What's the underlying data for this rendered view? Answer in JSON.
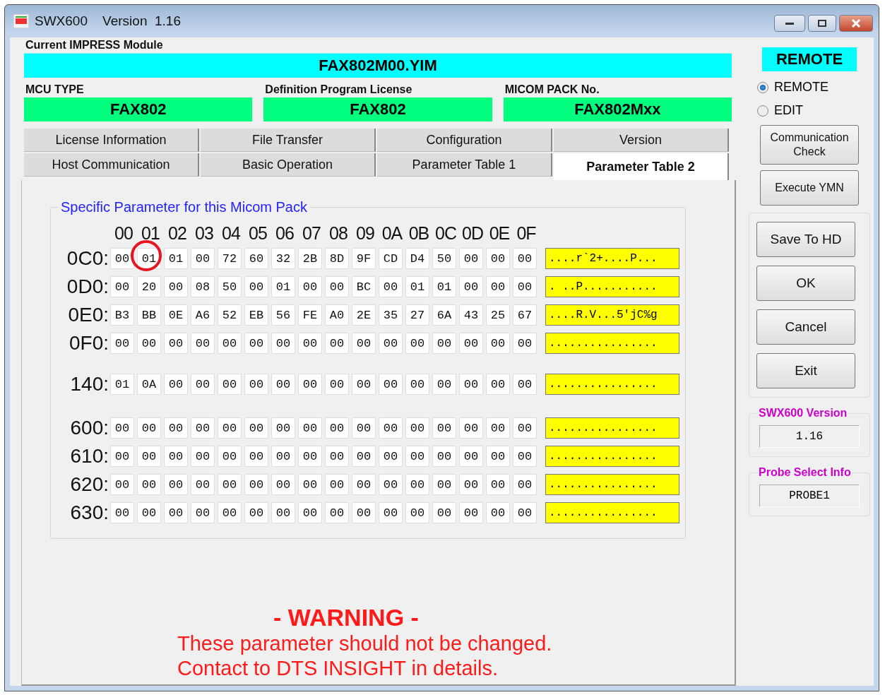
{
  "window": {
    "title": "SWX600    Version  1.16"
  },
  "module": {
    "label": "Current IMPRESS Module",
    "value": "FAX802M00.YIM"
  },
  "info_fields": [
    {
      "label": "MCU TYPE",
      "value": "FAX802"
    },
    {
      "label": "Definition Program License",
      "value": "FAX802"
    },
    {
      "label": "MICOM PACK No.",
      "value": "FAX802Mxx"
    }
  ],
  "tab_rows": [
    [
      {
        "label": "License Information",
        "selected": false
      },
      {
        "label": "File Transfer",
        "selected": false
      },
      {
        "label": "Configuration",
        "selected": false
      },
      {
        "label": "Version",
        "selected": false
      }
    ],
    [
      {
        "label": "Host Communication",
        "selected": false
      },
      {
        "label": "Basic Operation",
        "selected": false
      },
      {
        "label": "Parameter Table 1",
        "selected": false
      },
      {
        "label": "Parameter Table 2",
        "selected": true
      }
    ]
  ],
  "parameter_group": {
    "title": "Specific Parameter for this Micom Pack",
    "columns": [
      "00",
      "01",
      "02",
      "03",
      "04",
      "05",
      "06",
      "07",
      "08",
      "09",
      "0A",
      "0B",
      "0C",
      "0D",
      "0E",
      "0F"
    ],
    "blocks": [
      [
        {
          "address": "0C0:",
          "bytes": [
            "00",
            "01",
            "01",
            "00",
            "72",
            "60",
            "32",
            "2B",
            "8D",
            "9F",
            "CD",
            "D4",
            "50",
            "00",
            "00",
            "00"
          ],
          "circled": [
            false,
            true,
            false,
            false,
            false,
            false,
            false,
            false,
            false,
            false,
            false,
            false,
            false,
            false,
            false,
            false
          ],
          "ascii": "....r`2+....P..."
        },
        {
          "address": "0D0:",
          "bytes": [
            "00",
            "20",
            "00",
            "08",
            "50",
            "00",
            "01",
            "00",
            "00",
            "BC",
            "00",
            "01",
            "01",
            "00",
            "00",
            "00"
          ],
          "ascii": ". ..P..........."
        },
        {
          "address": "0E0:",
          "bytes": [
            "B3",
            "BB",
            "0E",
            "A6",
            "52",
            "EB",
            "56",
            "FE",
            "A0",
            "2E",
            "35",
            "27",
            "6A",
            "43",
            "25",
            "67"
          ],
          "ascii": "....R.V...5'jC%g"
        },
        {
          "address": "0F0:",
          "bytes": [
            "00",
            "00",
            "00",
            "00",
            "00",
            "00",
            "00",
            "00",
            "00",
            "00",
            "00",
            "00",
            "00",
            "00",
            "00",
            "00"
          ],
          "ascii": "................"
        }
      ],
      [
        {
          "address": "140:",
          "bytes": [
            "01",
            "0A",
            "00",
            "00",
            "00",
            "00",
            "00",
            "00",
            "00",
            "00",
            "00",
            "00",
            "00",
            "00",
            "00",
            "00"
          ],
          "ascii": "................"
        }
      ],
      [
        {
          "address": "600:",
          "bytes": [
            "00",
            "00",
            "00",
            "00",
            "00",
            "00",
            "00",
            "00",
            "00",
            "00",
            "00",
            "00",
            "00",
            "00",
            "00",
            "00"
          ],
          "ascii": "................"
        },
        {
          "address": "610:",
          "bytes": [
            "00",
            "00",
            "00",
            "00",
            "00",
            "00",
            "00",
            "00",
            "00",
            "00",
            "00",
            "00",
            "00",
            "00",
            "00",
            "00"
          ],
          "ascii": "................"
        },
        {
          "address": "620:",
          "bytes": [
            "00",
            "00",
            "00",
            "00",
            "00",
            "00",
            "00",
            "00",
            "00",
            "00",
            "00",
            "00",
            "00",
            "00",
            "00",
            "00"
          ],
          "ascii": "................"
        },
        {
          "address": "630:",
          "bytes": [
            "00",
            "00",
            "00",
            "00",
            "00",
            "00",
            "00",
            "00",
            "00",
            "00",
            "00",
            "00",
            "00",
            "00",
            "00",
            "00"
          ],
          "ascii": "................"
        }
      ]
    ]
  },
  "warning": {
    "title": "- WARNING -",
    "lines": [
      "These parameter should not be changed.",
      "Contact to DTS INSIGHT in details."
    ]
  },
  "side": {
    "mode_badge": "REMOTE",
    "modes": [
      {
        "label": "REMOTE",
        "selected": true
      },
      {
        "label": "EDIT",
        "selected": false
      }
    ],
    "tool_buttons": [
      "Communication\nCheck",
      "Execute YMN"
    ],
    "action_buttons": [
      "Save To HD",
      "OK",
      "Cancel",
      "Exit"
    ],
    "info_boxes": [
      {
        "title": "SWX600 Version",
        "value": "1.16"
      },
      {
        "title": "Probe Select Info",
        "value": "PROBE1"
      }
    ]
  }
}
